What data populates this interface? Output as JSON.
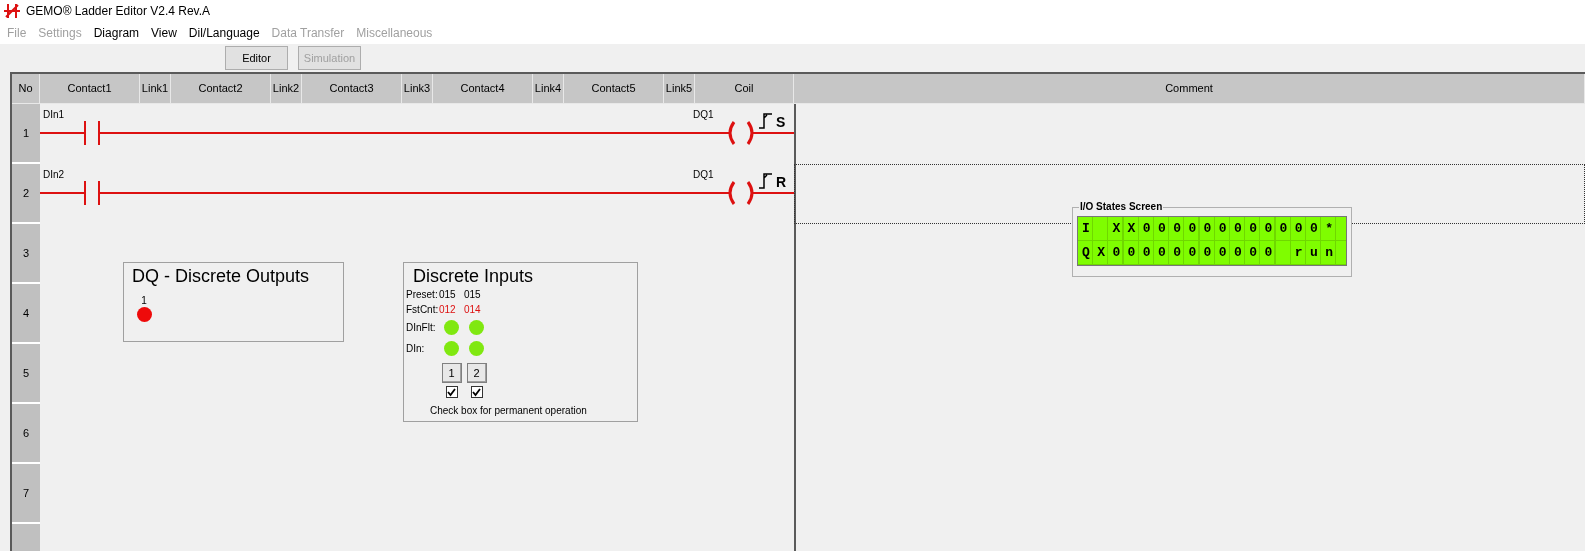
{
  "window": {
    "title": "GEMO® Ladder Editor V2.4 Rev.A"
  },
  "menu": [
    {
      "label": "File",
      "disabled": true
    },
    {
      "label": "Settings",
      "disabled": true
    },
    {
      "label": "Diagram",
      "disabled": false
    },
    {
      "label": "View",
      "disabled": false
    },
    {
      "label": "Dil/Language",
      "disabled": false
    },
    {
      "label": "Data Transfer",
      "disabled": true
    },
    {
      "label": "Miscellaneous",
      "disabled": true
    }
  ],
  "toolbar": [
    {
      "label": "Editor",
      "disabled": false
    },
    {
      "label": "Simulation",
      "disabled": true
    }
  ],
  "grid": {
    "columns": [
      {
        "label": "No",
        "kind": "number"
      },
      {
        "label": "Contact1",
        "kind": "contact"
      },
      {
        "label": "Link1",
        "kind": "link"
      },
      {
        "label": "Contact2",
        "kind": "contact"
      },
      {
        "label": "Link2",
        "kind": "link"
      },
      {
        "label": "Contact3",
        "kind": "contact"
      },
      {
        "label": "Link3",
        "kind": "link"
      },
      {
        "label": "Contact4",
        "kind": "contact"
      },
      {
        "label": "Link4",
        "kind": "link"
      },
      {
        "label": "Contact5",
        "kind": "contact"
      },
      {
        "label": "Link5",
        "kind": "link"
      },
      {
        "label": "Coil",
        "kind": "coil"
      },
      {
        "label": "Comment",
        "kind": "comment"
      }
    ],
    "rows": [
      {
        "number": "1",
        "selected": false,
        "rung": {
          "contact": "DIn1",
          "coil": "DQ1",
          "mode": "S"
        }
      },
      {
        "number": "2",
        "selected": true,
        "rung": {
          "contact": "DIn2",
          "coil": "DQ1",
          "mode": "R"
        }
      },
      {
        "number": "3",
        "selected": false
      },
      {
        "number": "4",
        "selected": false
      },
      {
        "number": "5",
        "selected": false
      },
      {
        "number": "6",
        "selected": false
      },
      {
        "number": "7",
        "selected": false
      },
      {
        "selected": false
      }
    ]
  },
  "outputs_panel": {
    "title": "DQ - Discrete Outputs",
    "outputs": [
      {
        "label": "1",
        "on": true
      }
    ]
  },
  "inputs_panel": {
    "title": "Discrete Inputs",
    "labels": {
      "preset": "Preset:",
      "fstcnt": "FstCnt:",
      "dinflt": "DInFlt:",
      "din": "DIn:"
    },
    "channels": [
      {
        "preset": "015",
        "fstcnt": "012",
        "filtered_on": true,
        "input_on": true,
        "button": "1",
        "checked": true
      },
      {
        "preset": "015",
        "fstcnt": "014",
        "filtered_on": true,
        "input_on": true,
        "button": "2",
        "checked": true
      }
    ],
    "note": "Check box for permanent operation"
  },
  "io_screen": {
    "title": "I/O States Screen",
    "lines": [
      "I XX000000000000*",
      "QX00000000000 run"
    ]
  }
}
